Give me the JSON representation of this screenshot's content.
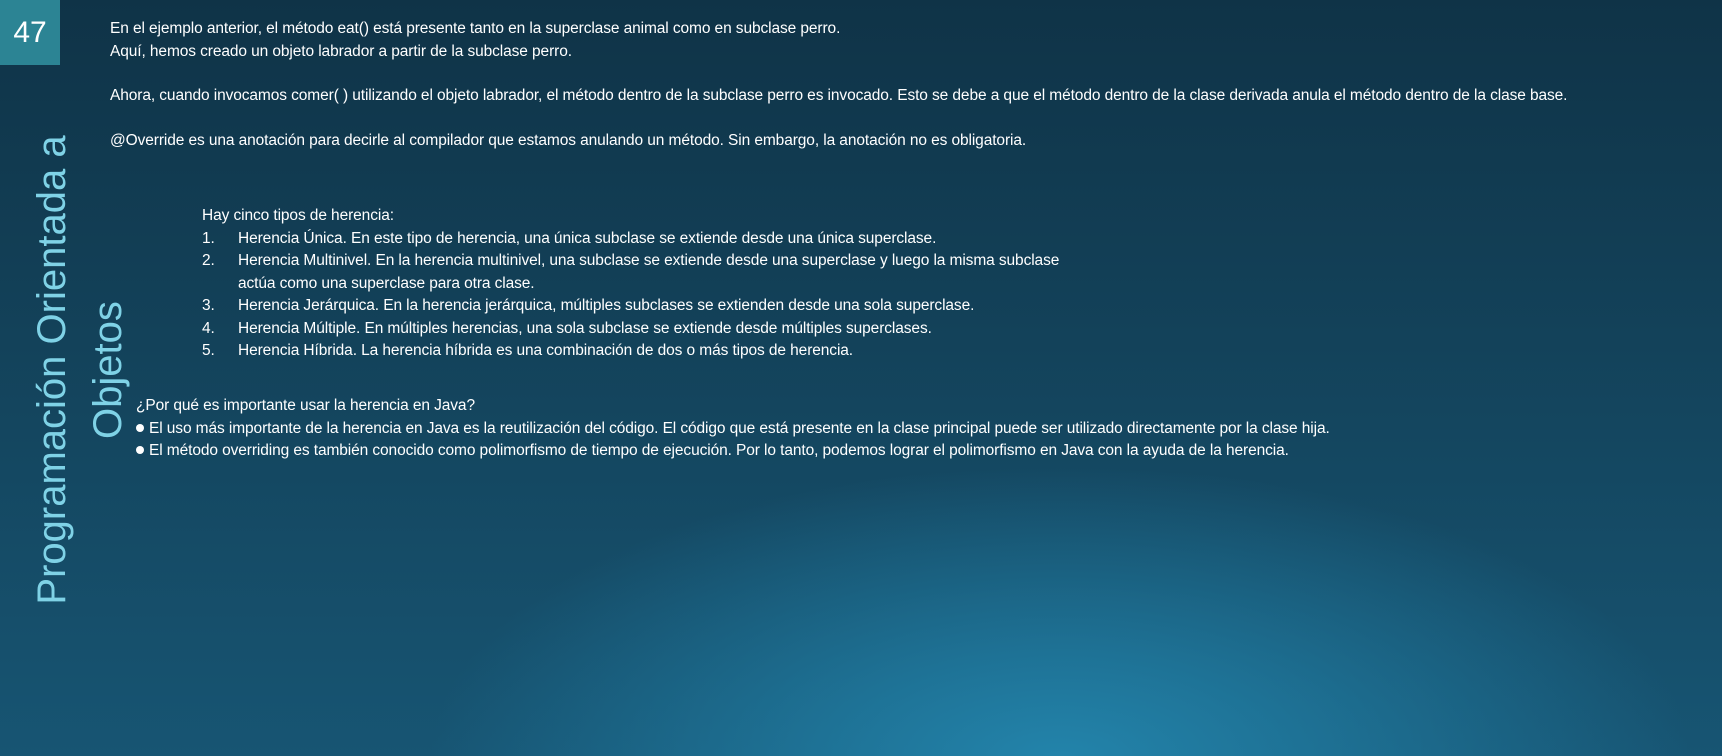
{
  "slide": {
    "number": "47",
    "title_line1": "Programación Orientada a",
    "title_line2": "Objetos"
  },
  "content": {
    "paragraph1_line1": "En el ejemplo anterior, el método eat() está presente tanto en la superclase animal como en subclase perro.",
    "paragraph1_line2": "Aquí, hemos creado un objeto labrador a partir de la subclase perro.",
    "paragraph2": "Ahora, cuando invocamos comer( ) utilizando el objeto labrador, el método dentro de la subclase perro es invocado. Esto se debe a que el método dentro de la clase derivada anula el método dentro de la clase base.",
    "paragraph3": "@Override es una anotación para decirle al compilador que estamos anulando un método. Sin embargo, la anotación no es obligatoria."
  },
  "inheritance": {
    "intro": "Hay cinco tipos de herencia:",
    "items": [
      {
        "num": "1.",
        "text": "Herencia Única. En este tipo de herencia, una única subclase se extiende desde una única superclase."
      },
      {
        "num": "2.",
        "text": "Herencia Multinivel. En la herencia multinivel, una subclase se extiende desde una superclase y luego la misma subclase actúa como una superclase para otra clase."
      },
      {
        "num": "3.",
        "text": " Herencia Jerárquica. En la herencia jerárquica, múltiples subclases se extienden desde una sola superclase."
      },
      {
        "num": "4.",
        "text": " Herencia Múltiple. En múltiples herencias, una sola subclase se extiende desde múltiples superclases."
      },
      {
        "num": "5.",
        "text": " Herencia Híbrida. La herencia híbrida es una combinación de dos o más tipos de herencia."
      }
    ]
  },
  "why": {
    "question": "¿Por qué es importante usar la herencia en Java?",
    "bullets": [
      "El uso más importante de la herencia en Java es la reutilización del código. El código que está presente en la clase principal puede ser utilizado directamente por la clase hija.",
      "El método overriding es también conocido como polimorfismo de tiempo de ejecución. Por lo tanto, podemos lograr el polimorfismo en Java con la ayuda de la herencia."
    ]
  }
}
